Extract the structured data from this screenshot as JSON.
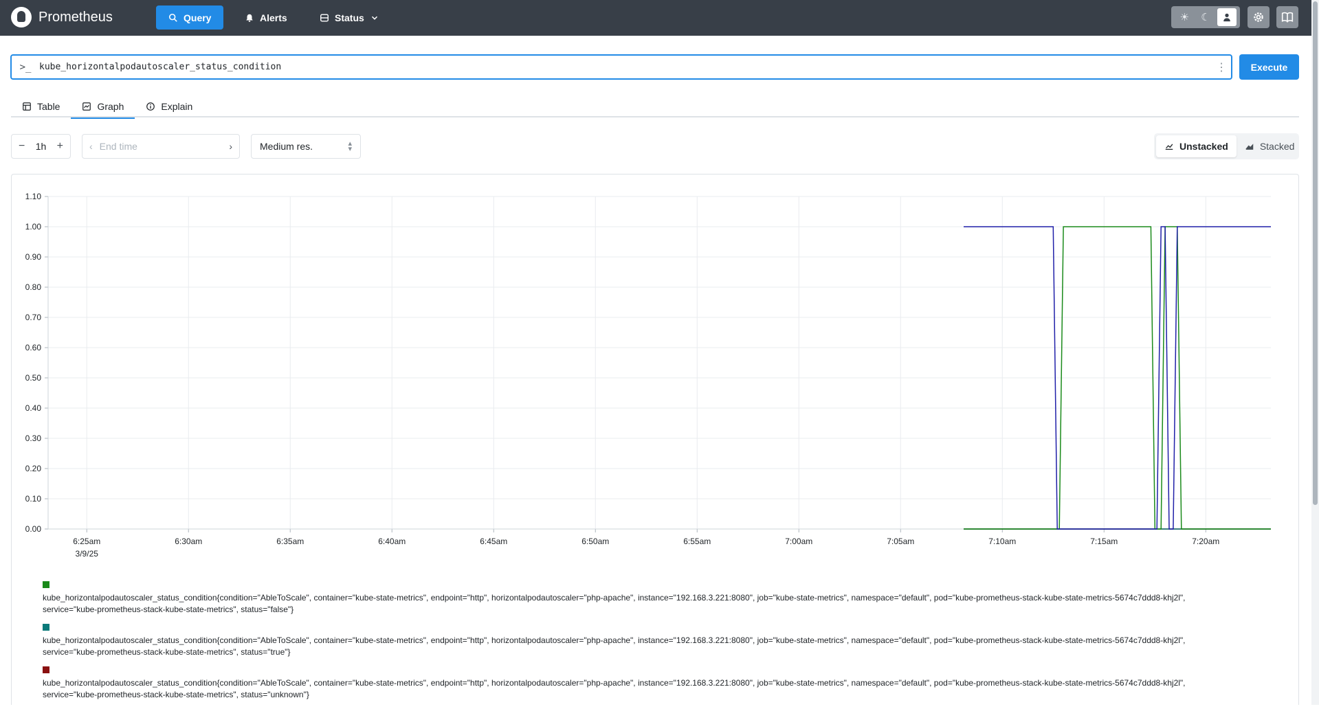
{
  "app": {
    "name": "Prometheus"
  },
  "nav": {
    "query_label": "Query",
    "alerts_label": "Alerts",
    "status_label": "Status"
  },
  "query": {
    "prompt": ">_",
    "expression": "kube_horizontalpodautoscaler_status_condition",
    "execute_label": "Execute"
  },
  "tabs": [
    {
      "label": "Table"
    },
    {
      "label": "Graph"
    },
    {
      "label": "Explain"
    }
  ],
  "controls": {
    "range": "1h",
    "end_time_placeholder": "End time",
    "resolution": "Medium res.",
    "unstacked_label": "Unstacked",
    "stacked_label": "Stacked"
  },
  "colors": {
    "accent": "#228be6",
    "topbar": "#383f48"
  },
  "chart_data": {
    "type": "line",
    "ylim": [
      0,
      1.1
    ],
    "y_ticks": [
      "0.00",
      "0.10",
      "0.20",
      "0.30",
      "0.40",
      "0.50",
      "0.60",
      "0.70",
      "0.80",
      "0.90",
      "1.00",
      "1.10"
    ],
    "x_ticks": [
      "6:25am",
      "6:30am",
      "6:35am",
      "6:40am",
      "6:45am",
      "6:50am",
      "6:55am",
      "7:00am",
      "7:05am",
      "7:10am",
      "7:15am",
      "7:20am"
    ],
    "x_tick_minutes": [
      0,
      5,
      10,
      15,
      20,
      25,
      30,
      35,
      40,
      45,
      50,
      55
    ],
    "x_date": "3/9/25",
    "x_range_minutes": [
      -1.9,
      58.2
    ],
    "grid": true,
    "series": [
      {
        "color": "#1a8a1a",
        "points": [
          [
            43.1,
            0
          ],
          [
            47.8,
            0
          ],
          [
            48.0,
            1
          ],
          [
            52.3,
            1
          ],
          [
            52.5,
            0
          ],
          [
            52.8,
            0
          ],
          [
            53.0,
            1
          ],
          [
            53.6,
            1
          ],
          [
            53.8,
            0
          ],
          [
            58.2,
            0
          ]
        ]
      },
      {
        "color": "#1f1fa8",
        "points": [
          [
            43.1,
            1
          ],
          [
            47.5,
            1
          ],
          [
            47.7,
            0
          ],
          [
            52.6,
            0
          ],
          [
            52.8,
            1
          ],
          [
            53.0,
            1
          ],
          [
            53.2,
            0
          ],
          [
            53.4,
            0
          ],
          [
            53.6,
            1
          ],
          [
            58.2,
            1
          ]
        ]
      },
      {
        "color": "#0b7a7a",
        "points": [
          [
            43.1,
            0
          ],
          [
            58.2,
            0
          ]
        ]
      },
      {
        "color": "#8a1010",
        "points": [
          [
            43.1,
            0
          ],
          [
            58.2,
            0
          ]
        ]
      }
    ]
  },
  "legend": [
    {
      "color": "#1a8a1a",
      "line1": "kube_horizontalpodautoscaler_status_condition{condition=\"AbleToScale\", container=\"kube-state-metrics\", endpoint=\"http\", horizontalpodautoscaler=\"php-apache\", instance=\"192.168.3.221:8080\", job=\"kube-state-metrics\", namespace=\"default\", pod=\"kube-prometheus-stack-kube-state-metrics-5674c7ddd8-khj2l\",",
      "line2": "service=\"kube-prometheus-stack-kube-state-metrics\", status=\"false\"}"
    },
    {
      "color": "#0b7a7a",
      "line1": "kube_horizontalpodautoscaler_status_condition{condition=\"AbleToScale\", container=\"kube-state-metrics\", endpoint=\"http\", horizontalpodautoscaler=\"php-apache\", instance=\"192.168.3.221:8080\", job=\"kube-state-metrics\", namespace=\"default\", pod=\"kube-prometheus-stack-kube-state-metrics-5674c7ddd8-khj2l\",",
      "line2": "service=\"kube-prometheus-stack-kube-state-metrics\", status=\"true\"}"
    },
    {
      "color": "#8a1010",
      "line1": "kube_horizontalpodautoscaler_status_condition{condition=\"AbleToScale\", container=\"kube-state-metrics\", endpoint=\"http\", horizontalpodautoscaler=\"php-apache\", instance=\"192.168.3.221:8080\", job=\"kube-state-metrics\", namespace=\"default\", pod=\"kube-prometheus-stack-kube-state-metrics-5674c7ddd8-khj2l\",",
      "line2": "service=\"kube-prometheus-stack-kube-state-metrics\", status=\"unknown\"}"
    }
  ]
}
